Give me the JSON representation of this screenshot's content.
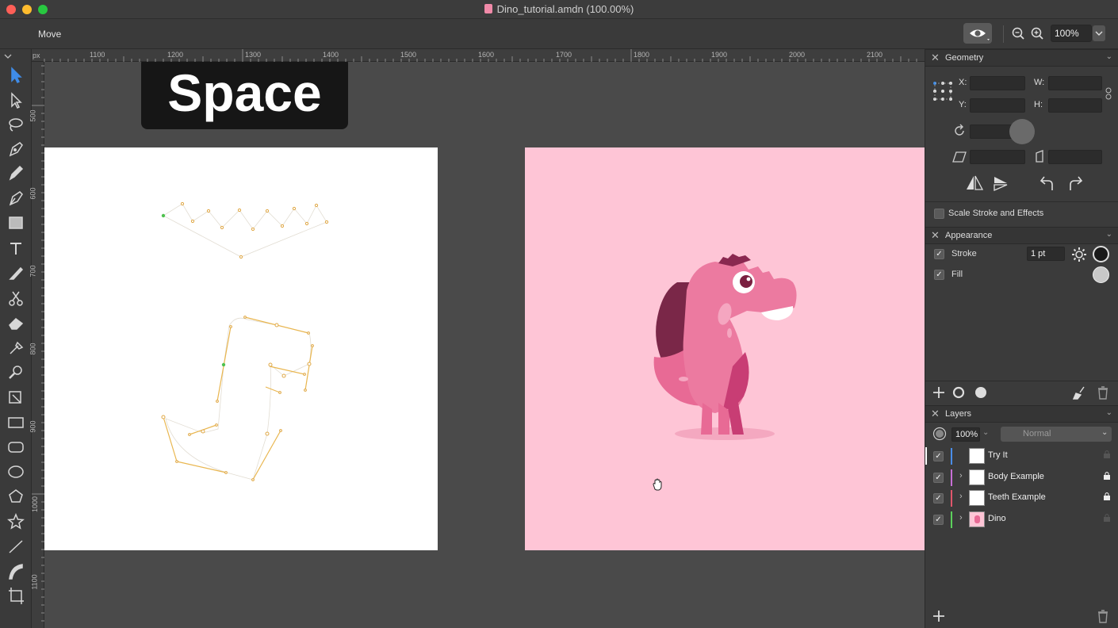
{
  "window": {
    "title": "Dino_tutorial.amdn (100.00%)",
    "traffic_colors": [
      "#fe5f57",
      "#febc2e",
      "#28c840"
    ]
  },
  "toolbar": {
    "tool_name": "Move",
    "zoom_value": "100%",
    "icons": [
      "eye-icon",
      "zoom-out-icon",
      "zoom-in-icon",
      "chevron-down-icon"
    ]
  },
  "ruler": {
    "unit": "px",
    "top_labels": [
      "1100",
      "1200",
      "1300",
      "1400",
      "1500",
      "1600",
      "1700",
      "1800",
      "1900",
      "2000",
      "2100"
    ],
    "left_labels": [
      "500",
      "600",
      "700",
      "800",
      "900",
      "1000",
      "1100"
    ]
  },
  "tools": [
    "select-icon",
    "direct-select-icon",
    "lasso-icon",
    "pen-icon",
    "pencil-icon",
    "brush-icon",
    "gradient-icon",
    "text-icon",
    "knife-icon",
    "scissors-icon",
    "eraser-icon",
    "eyedropper-icon",
    "zoom-icon",
    "transform-icon",
    "rectangle-icon",
    "rounded-rect-icon",
    "ellipse-icon",
    "polygon-icon",
    "star-icon",
    "line-icon",
    "curve-icon",
    "artboard-icon"
  ],
  "canvas": {
    "overlay_text": "Space",
    "artboard1_bg": "#ffffff",
    "artboard2_bg": "#fec5d6",
    "path_color": "#e9b64f"
  },
  "geometry": {
    "title": "Geometry",
    "x_label": "X:",
    "y_label": "Y:",
    "w_label": "W:",
    "h_label": "H:",
    "scale_label": "Scale Stroke and Effects"
  },
  "appearance": {
    "title": "Appearance",
    "stroke_label": "Stroke",
    "stroke_value": "1 pt",
    "fill_label": "Fill"
  },
  "layers": {
    "title": "Layers",
    "opacity": "100%",
    "blend": "Normal",
    "items": [
      {
        "name": "Try It",
        "color": "#4a8de8"
      },
      {
        "name": "Body Example",
        "color": "#c86fd6"
      },
      {
        "name": "Teeth Example",
        "color": "#e0566b"
      },
      {
        "name": "Dino",
        "color": "#5cd05c"
      }
    ]
  }
}
